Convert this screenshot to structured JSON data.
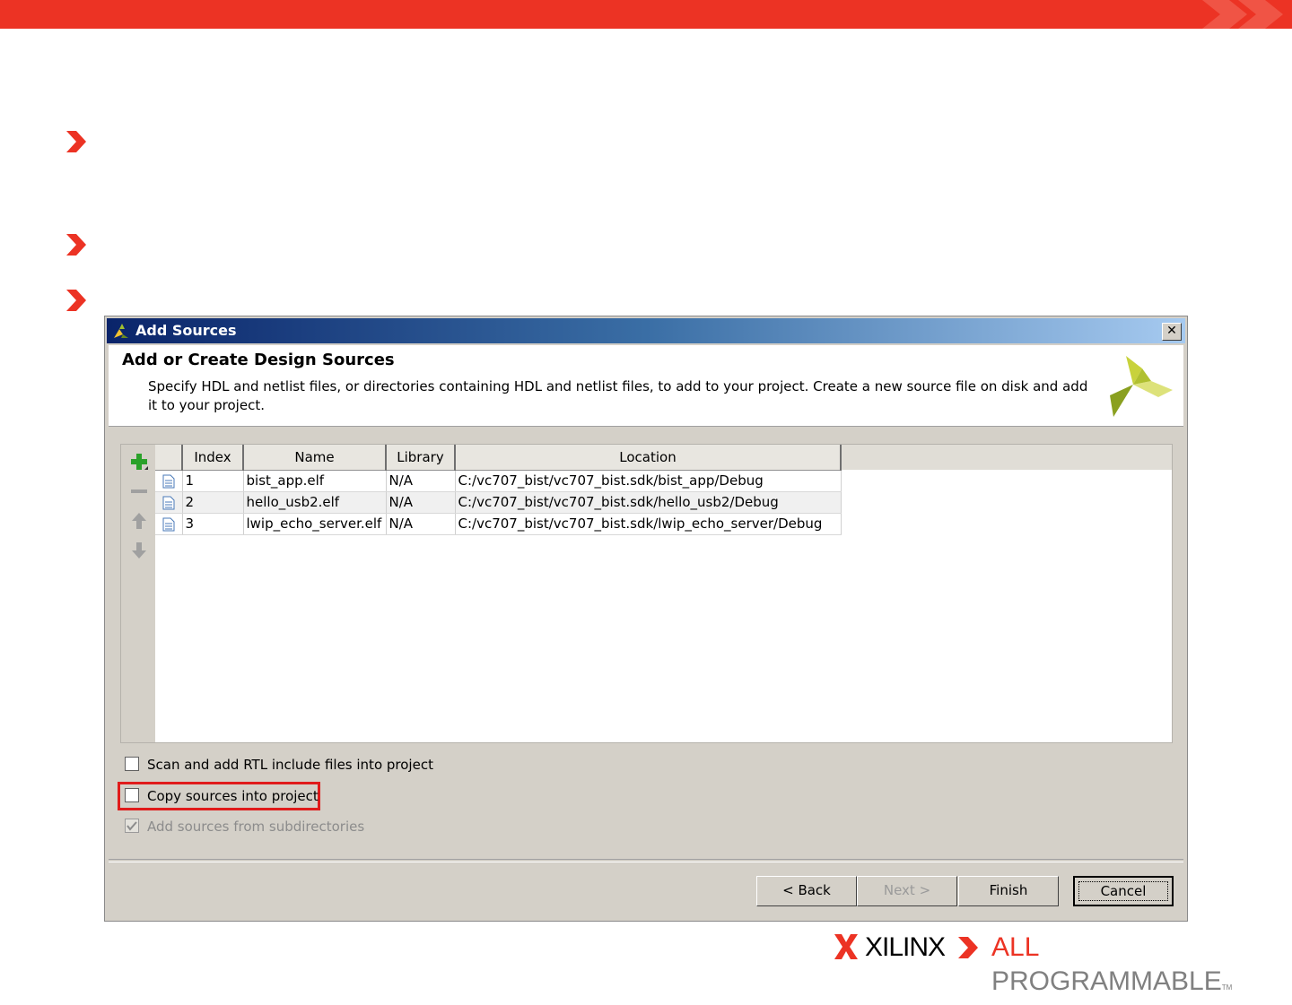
{
  "dialog": {
    "title": "Add Sources",
    "close_glyph": "✕",
    "header_title": "Add or Create Design Sources",
    "header_description": "Specify HDL and netlist files, or directories containing HDL and netlist files, to add to your project. Create a new source file on disk and add it to your project."
  },
  "table": {
    "columns": [
      "Index",
      "Name",
      "Library",
      "Location"
    ],
    "rows": [
      {
        "index": "1",
        "name": "bist_app.elf",
        "library": "N/A",
        "location": "C:/vc707_bist/vc707_bist.sdk/bist_app/Debug"
      },
      {
        "index": "2",
        "name": "hello_usb2.elf",
        "library": "N/A",
        "location": "C:/vc707_bist/vc707_bist.sdk/hello_usb2/Debug"
      },
      {
        "index": "3",
        "name": "lwip_echo_server.elf",
        "library": "N/A",
        "location": "C:/vc707_bist/vc707_bist.sdk/lwip_echo_server/Debug"
      }
    ],
    "tools": [
      "add-icon",
      "remove-icon",
      "move-up-icon",
      "move-down-icon"
    ]
  },
  "options": {
    "scan_rtl": {
      "label": "Scan and add RTL include files into project",
      "checked": false,
      "enabled": true
    },
    "copy_sources": {
      "label": "Copy sources into project",
      "checked": false,
      "enabled": true,
      "highlighted": true
    },
    "add_subdirs": {
      "label": "Add sources from subdirectories",
      "checked": true,
      "enabled": false
    }
  },
  "buttons": {
    "back": "< Back",
    "next": "Next >",
    "finish": "Finish",
    "cancel": "Cancel"
  },
  "branding": {
    "company": "XILINX",
    "tagline_first": "ALL",
    "tagline_rest": " PROGRAMMABLE",
    "trademark": "TM"
  },
  "colors": {
    "accent_red": "#ec3324",
    "dialog_gray": "#d4d0c8",
    "title_blue": "#0a246a",
    "highlight_red": "#e01b1b"
  }
}
